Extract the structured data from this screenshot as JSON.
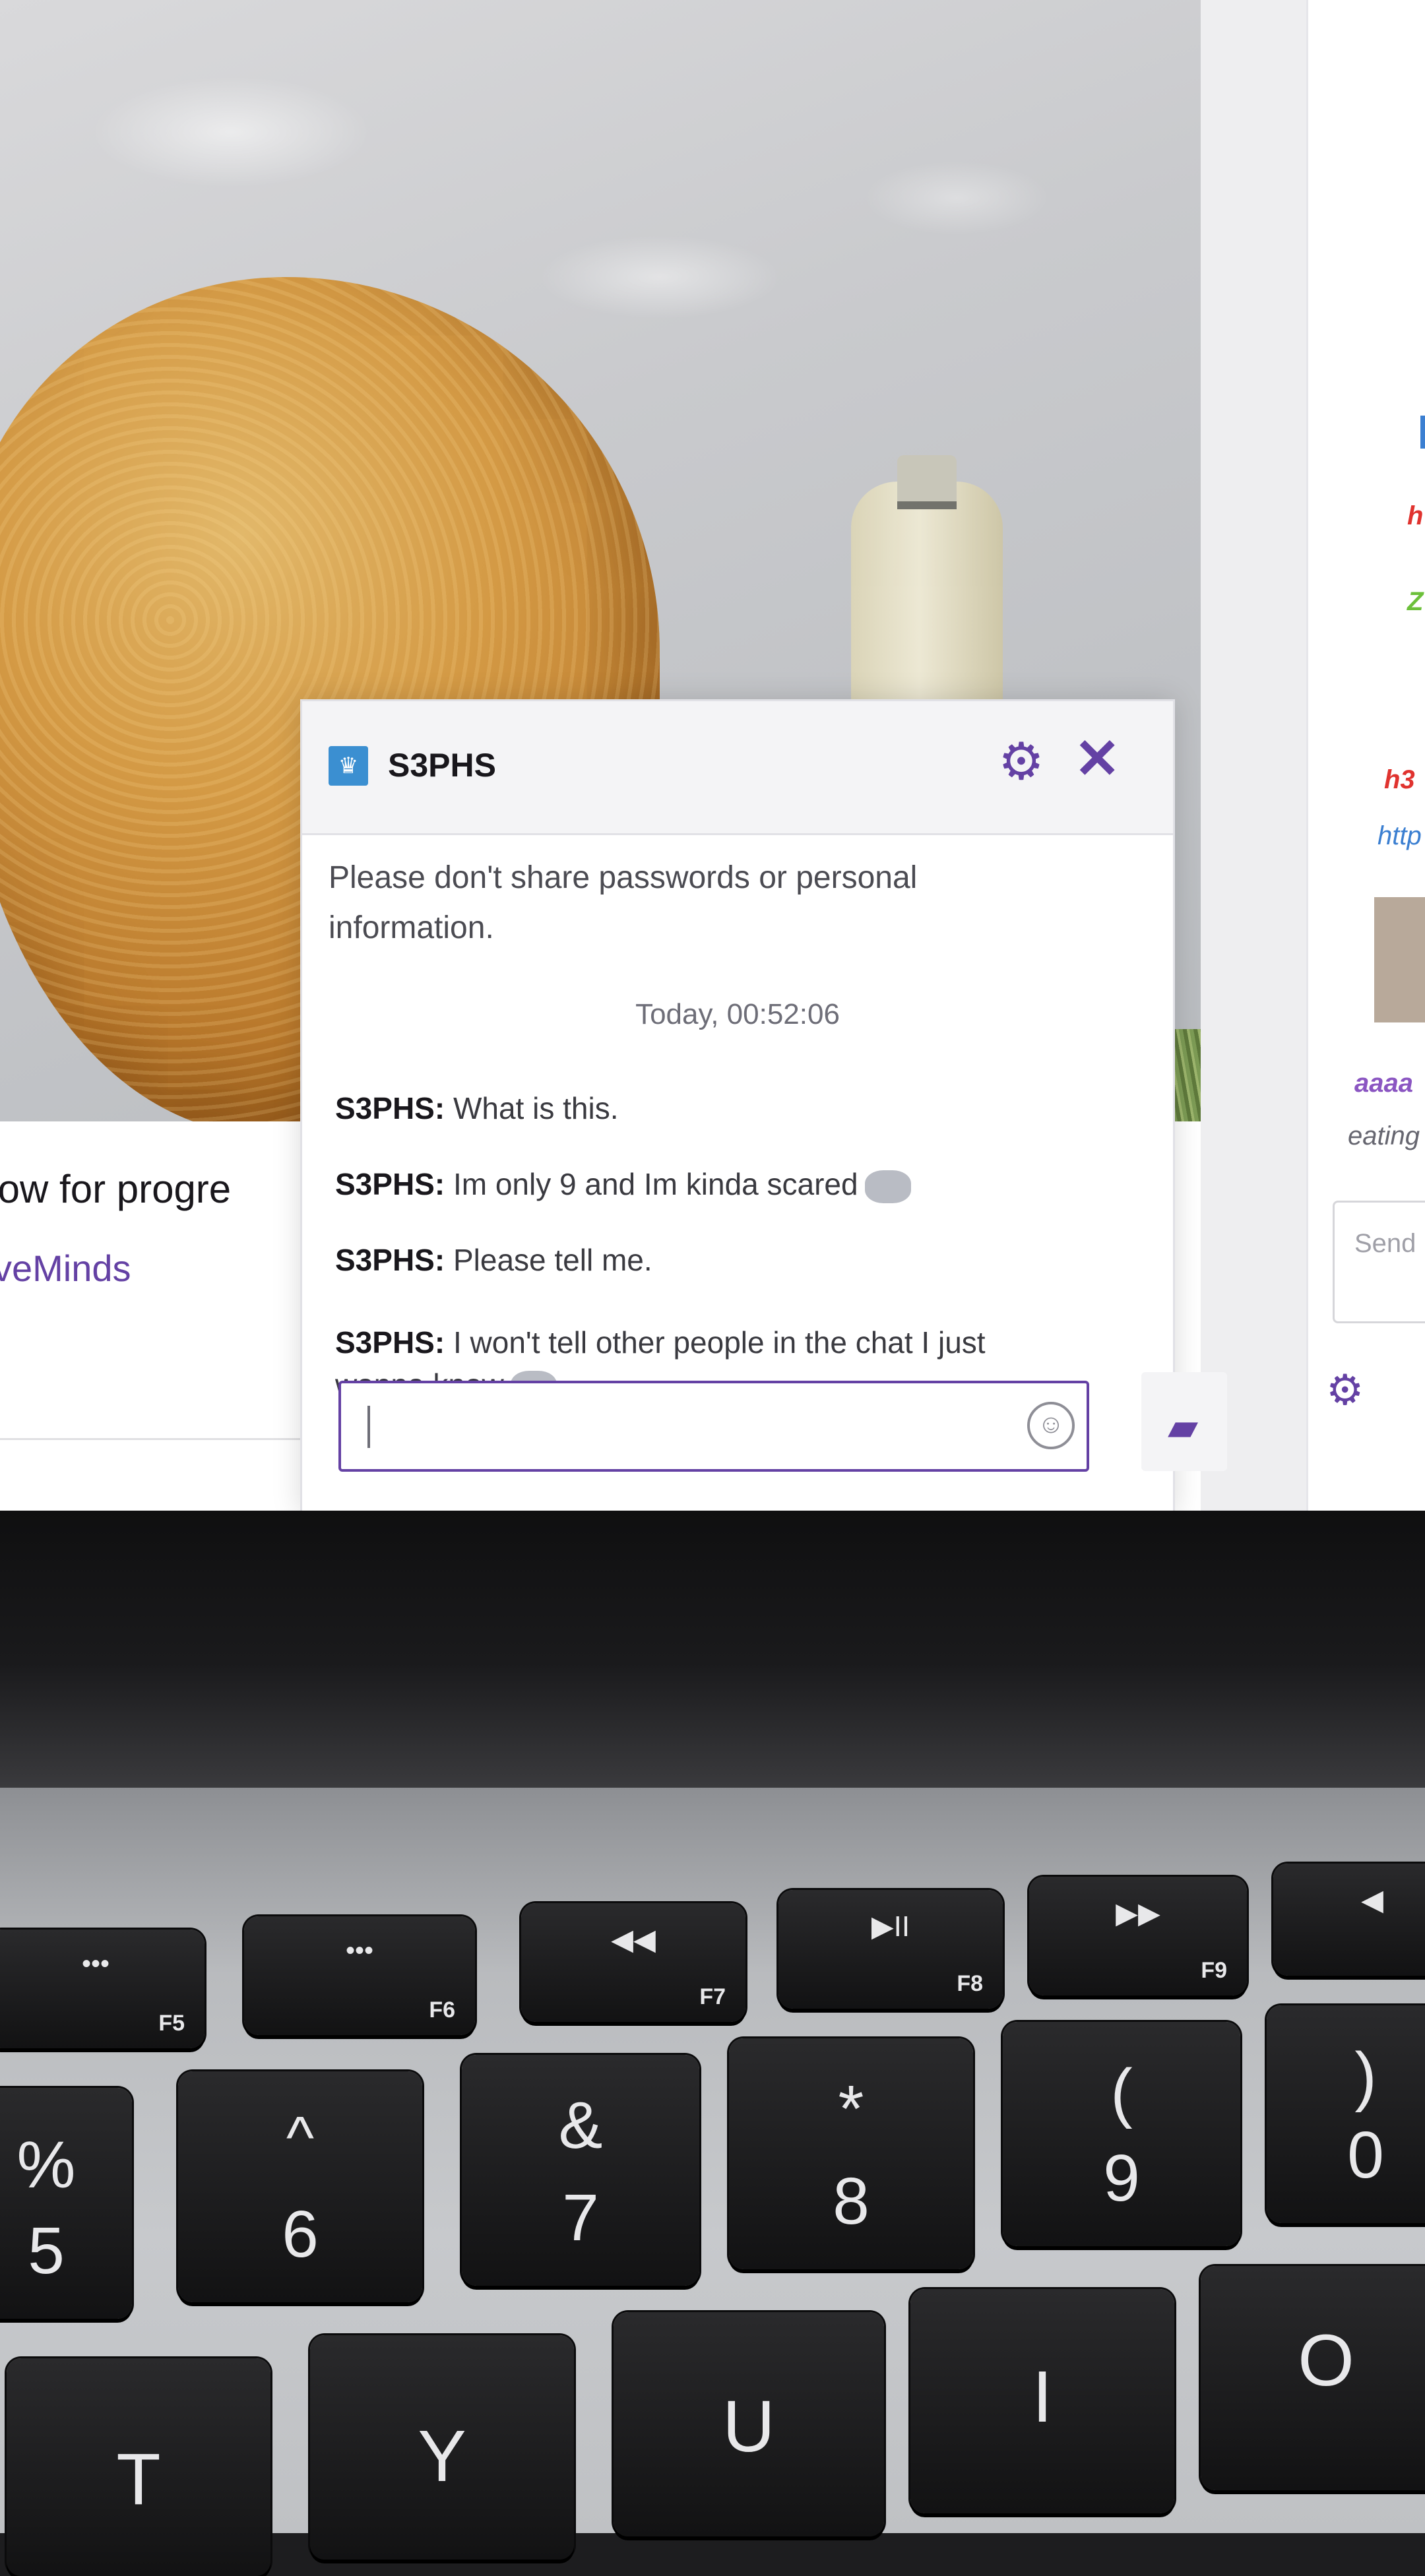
{
  "page": {
    "follow_text": "llow for progre",
    "channel_link": "veMinds"
  },
  "right_chat": {
    "messages": [
      {
        "text": "h",
        "color": "#e0332f"
      },
      {
        "text": "Z",
        "color": "#6cc03a"
      },
      {
        "text": "h3",
        "color": "#e0332f"
      },
      {
        "text": "http",
        "color": "#3b7fd1"
      },
      {
        "text": "aaaa",
        "color": "#8b56c2"
      },
      {
        "text": "eating",
        "color": "#666670"
      }
    ],
    "send_placeholder": "Send"
  },
  "whisper": {
    "username": "S3PHS",
    "notice": "Please don't share passwords or personal information.",
    "timestamp": "Today, 00:52:06",
    "messages": [
      {
        "user": "S3PHS",
        "text": "What is this."
      },
      {
        "user": "S3PHS",
        "text": "Im only 9 and Im kinda scared"
      },
      {
        "user": "S3PHS",
        "text": "Please tell me."
      },
      {
        "user": "S3PHS",
        "text": "I won't tell other people in the chat I just wanna know"
      }
    ],
    "input_value": "",
    "accent_color": "#6441a4"
  },
  "keyboard": {
    "fn_row": [
      {
        "icon": "brightness-down-icon",
        "glyph": "•••",
        "label": "F5"
      },
      {
        "icon": "brightness-up-icon",
        "glyph": "•••",
        "label": "F6"
      },
      {
        "icon": "rewind-icon",
        "glyph": "◀◀",
        "label": "F7"
      },
      {
        "icon": "play-pause-icon",
        "glyph": "▶II",
        "label": "F8"
      },
      {
        "icon": "fast-forward-icon",
        "glyph": "▶▶",
        "label": "F9"
      },
      {
        "icon": "mute-icon",
        "glyph": "◀",
        "label": ""
      }
    ],
    "number_row": [
      {
        "top": "%",
        "bottom": "5"
      },
      {
        "top": "^",
        "bottom": "6"
      },
      {
        "top": "&",
        "bottom": "7"
      },
      {
        "top": "*",
        "bottom": "8"
      },
      {
        "top": "(",
        "bottom": "9"
      },
      {
        "top": ")",
        "bottom": "0"
      }
    ],
    "letter_row": [
      "T",
      "Y",
      "U",
      "I",
      "O"
    ]
  }
}
